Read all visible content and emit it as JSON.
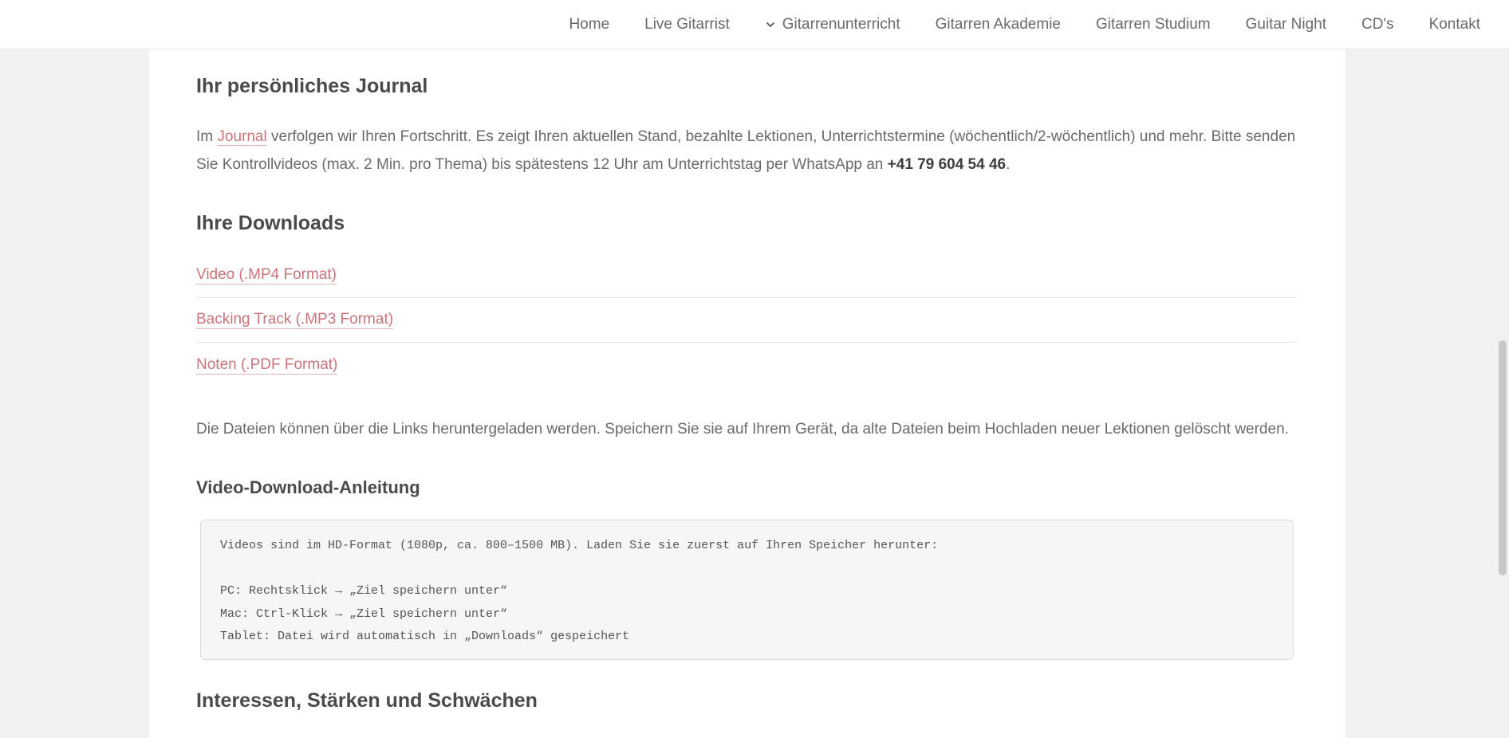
{
  "nav": {
    "items": [
      {
        "label": "Home"
      },
      {
        "label": "Live Gitarrist"
      },
      {
        "label": "Gitarrenunterricht",
        "has_dropdown": true
      },
      {
        "label": "Gitarren Akademie"
      },
      {
        "label": "Gitarren Studium"
      },
      {
        "label": "Guitar Night"
      },
      {
        "label": "CD's"
      },
      {
        "label": "Kontakt"
      }
    ]
  },
  "journal": {
    "heading": "Ihr persönliches Journal",
    "text_before_link": "Im ",
    "link_label": "Journal",
    "text_after_link": " verfolgen wir Ihren Fortschritt. Es zeigt Ihren aktuellen Stand, bezahlte Lektionen, Unterrichtstermine (wöchentlich/2-wöchentlich) und mehr. Bitte senden Sie Kontrollvideos (max. 2 Min. pro Thema) bis spätestens 12 Uhr am Unterrichtstag per WhatsApp an ",
    "phone": "+41 79 604 54 46",
    "text_end": "."
  },
  "downloads": {
    "heading": "Ihre Downloads",
    "links": [
      {
        "label": "Video (.MP4 Format)"
      },
      {
        "label": "Backing Track (.MP3 Format)"
      },
      {
        "label": "Noten (.PDF Format)"
      }
    ],
    "note": "Die Dateien können über die Links heruntergeladen werden. Speichern Sie sie auf Ihrem Gerät, da alte Dateien beim Hochladen neuer Lektionen gelöscht werden."
  },
  "video_guide": {
    "heading": "Video-Download-Anleitung",
    "lines": [
      "Videos sind im HD-Format (1080p, ca. 800–1500 MB). Laden Sie sie zuerst auf Ihren Speicher herunter:",
      "",
      "PC: Rechtsklick → „Ziel speichern unter“",
      "Mac: Ctrl-Klick → „Ziel speichern unter“",
      "Tablet: Datei wird automatisch in „Downloads“ gespeichert"
    ]
  },
  "interests": {
    "heading": "Interessen, Stärken und Schwächen"
  },
  "colors": {
    "link": "#c9747a",
    "page_bg": "#f1f1f1",
    "panel_bg": "#ffffff"
  },
  "icons": {
    "dropdown": "chevron-down-icon"
  }
}
